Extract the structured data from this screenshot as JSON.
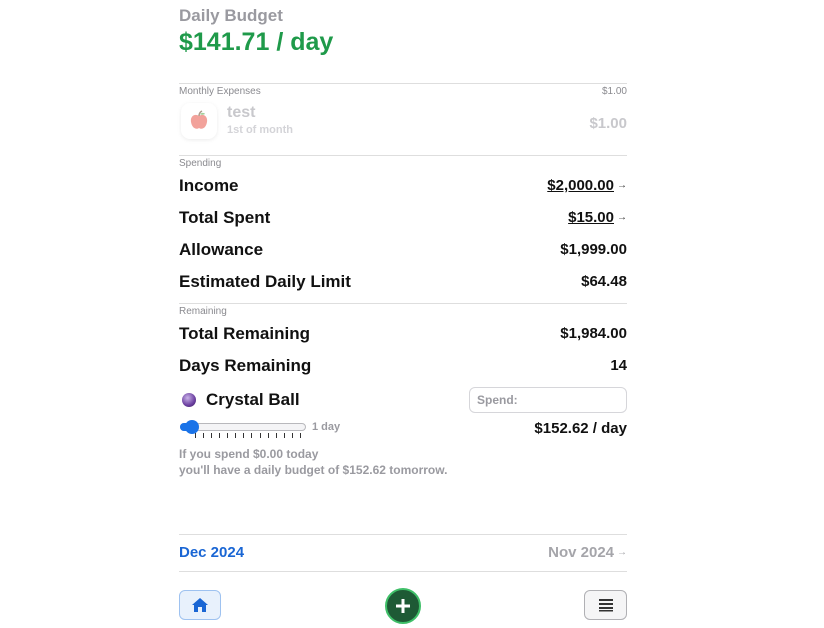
{
  "header": {
    "title": "Daily Budget",
    "value": "$141.71 / day"
  },
  "monthly_expenses": {
    "label": "Monthly Expenses",
    "total": "$1.00",
    "items": [
      {
        "name": "test",
        "schedule": "1st of month",
        "amount": "$1.00",
        "icon": "apple-icon"
      }
    ]
  },
  "spending": {
    "label": "Spending",
    "income": {
      "label": "Income",
      "value": "$2,000.00"
    },
    "total_spent": {
      "label": "Total Spent",
      "value": "$15.00"
    },
    "allowance": {
      "label": "Allowance",
      "value": "$1,999.00"
    },
    "estimated_daily_limit": {
      "label": "Estimated Daily Limit",
      "value": "$64.48"
    }
  },
  "remaining": {
    "label": "Remaining",
    "total_remaining": {
      "label": "Total Remaining",
      "value": "$1,984.00"
    },
    "days_remaining": {
      "label": "Days Remaining",
      "value": "14"
    }
  },
  "crystal_ball": {
    "label": "Crystal Ball",
    "icon": "crystal-ball-icon",
    "spend_placeholder": "Spend:",
    "spend_value": "",
    "slider_label": "1 day",
    "slider_days": 1,
    "projected_value": "$152.62 / day",
    "note_line1": "If you spend $0.00 today",
    "note_line2": "you'll have a daily budget of $152.62 tomorrow."
  },
  "months": {
    "current": "Dec 2024",
    "previous": "Nov 2024"
  },
  "colors": {
    "accent_green": "#1f9a4a",
    "accent_blue": "#1a66d4",
    "add_button": "#1e5a35"
  },
  "nav": {
    "home_icon": "home-icon",
    "add_icon": "plus-icon",
    "menu_icon": "menu-icon"
  }
}
